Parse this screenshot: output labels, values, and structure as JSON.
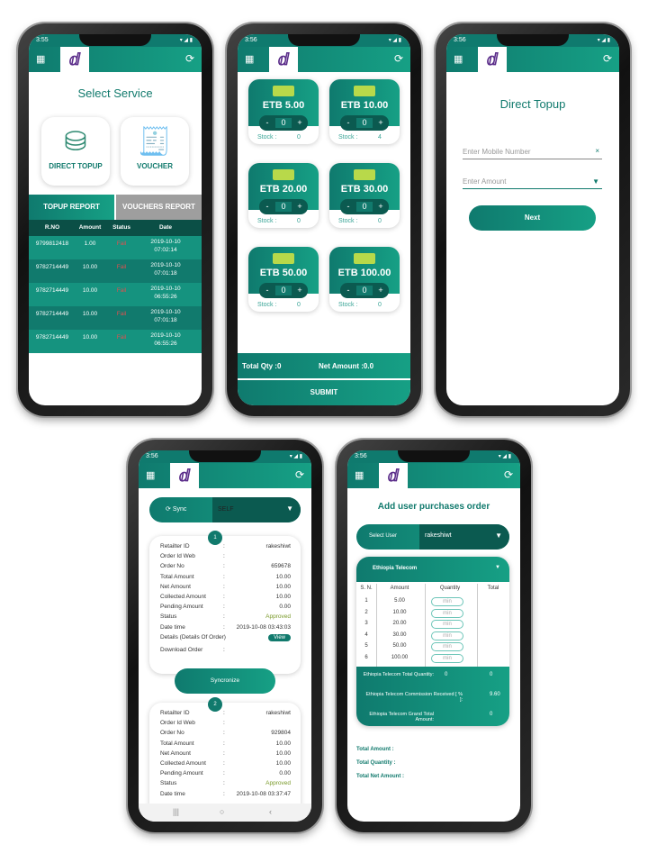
{
  "common": {
    "logo": "d",
    "grid_icon": "grid-icon",
    "refresh_icon": "refresh-icon"
  },
  "colors": {
    "primary": "#0f7a6e",
    "secondary": "#16a085",
    "dark": "#0b5a50",
    "fail": "#e05050",
    "approved": "#7a9a2a"
  },
  "phone1": {
    "time": "3:55",
    "title": "Select Service",
    "services": [
      {
        "label": "DIRECT TOPUP",
        "icon": "coins-icon"
      },
      {
        "label": "VOUCHER",
        "icon": "receipt-icon"
      }
    ],
    "tabs": [
      "TOPUP REPORT",
      "VOUCHERS REPORT"
    ],
    "columns": [
      "R.NO",
      "Amount",
      "Status",
      "Date"
    ],
    "rows": [
      [
        "9799812418",
        "1.00",
        "Fail",
        "2019-10-10",
        "07:02:14"
      ],
      [
        "9782714449",
        "10.00",
        "Fail",
        "2019-10-10",
        "07:01:18"
      ],
      [
        "9782714449",
        "10.00",
        "Fail",
        "2019-10-10",
        "06:55:26"
      ],
      [
        "9782714449",
        "10.00",
        "Fail",
        "2019-10-10",
        "07:01:18"
      ],
      [
        "9782714449",
        "10.00",
        "Fail",
        "2019-10-10",
        "06:55:26"
      ]
    ]
  },
  "phone2": {
    "time": "3:56",
    "vouchers": [
      {
        "amount": "ETB 5.00",
        "qty": "0",
        "stock": "0"
      },
      {
        "amount": "ETB 10.00",
        "qty": "0",
        "stock": "4"
      },
      {
        "amount": "ETB 20.00",
        "qty": "0",
        "stock": "0"
      },
      {
        "amount": "ETB 30.00",
        "qty": "0",
        "stock": "0"
      },
      {
        "amount": "ETB 50.00",
        "qty": "0",
        "stock": "0"
      },
      {
        "amount": "ETB 100.00",
        "qty": "0",
        "stock": "0"
      }
    ],
    "stock_label": "Stock :",
    "minus": "-",
    "plus": "+",
    "total_qty": "Total Qty :0",
    "net_amount": "Net Amount :0.0",
    "submit": "SUBMIT"
  },
  "phone3": {
    "time": "3:56",
    "title": "Direct Topup",
    "mobile_placeholder": "Enter Mobile Number",
    "amount_placeholder": "Enter Amount",
    "next": "Next"
  },
  "phone4": {
    "time": "3:56",
    "sync_label": "Sync",
    "select_value": "SELF",
    "syncronize": "Syncronize",
    "view": "View",
    "orders": [
      {
        "n": "1",
        "fields": [
          [
            "Retailter ID",
            "rakeshiwt"
          ],
          [
            "Order Id Web",
            ""
          ],
          [
            "Order No",
            "659678"
          ],
          [
            "Total Amount",
            "10.00"
          ],
          [
            "Net Amount",
            "10.00"
          ],
          [
            "Collected Amount",
            "10.00"
          ],
          [
            "Pending Amount",
            "0.00"
          ],
          [
            "Status",
            "Approved"
          ],
          [
            "Date time",
            "2019-10-08 03:43:03"
          ],
          [
            "Details (Details Of Order)",
            ""
          ],
          [
            "Download Order",
            ""
          ]
        ]
      },
      {
        "n": "2",
        "fields": [
          [
            "Retailter ID",
            "rakeshiwt"
          ],
          [
            "Order Id Web",
            ""
          ],
          [
            "Order No",
            "929804"
          ],
          [
            "Total Amount",
            "10.00"
          ],
          [
            "Net Amount",
            "10.00"
          ],
          [
            "Collected Amount",
            "10.00"
          ],
          [
            "Pending Amount",
            "0.00"
          ],
          [
            "Status",
            "Approved"
          ],
          [
            "Date time",
            "2019-10-08 03:37:47"
          ]
        ]
      }
    ]
  },
  "phone5": {
    "time": "3:56",
    "title": "Add user purchases order",
    "select_user_label": "Select User",
    "select_user_value": "rakeshiwt",
    "operator": "Ethiopia Telecom",
    "columns": [
      "S. N.",
      "Amount",
      "Quantity",
      "Total"
    ],
    "rows": [
      [
        "1",
        "5.00"
      ],
      [
        "2",
        "10.00"
      ],
      [
        "3",
        "20.00"
      ],
      [
        "4",
        "30.00"
      ],
      [
        "5",
        "50.00"
      ],
      [
        "6",
        "100.00"
      ]
    ],
    "qty_placeholder": "min",
    "summary": [
      [
        "Ethiopia Telecom Total Quantity:",
        "0",
        "0"
      ],
      [
        "Ethiopia Telecom Commission Received [ % ]:",
        "",
        "9.60"
      ],
      [
        "Ethiopia Telecom Grand Total Amount:",
        "",
        "0"
      ]
    ],
    "totals": [
      "Total Amount :",
      "Total Quantity :",
      "Total Net Amount :"
    ]
  }
}
